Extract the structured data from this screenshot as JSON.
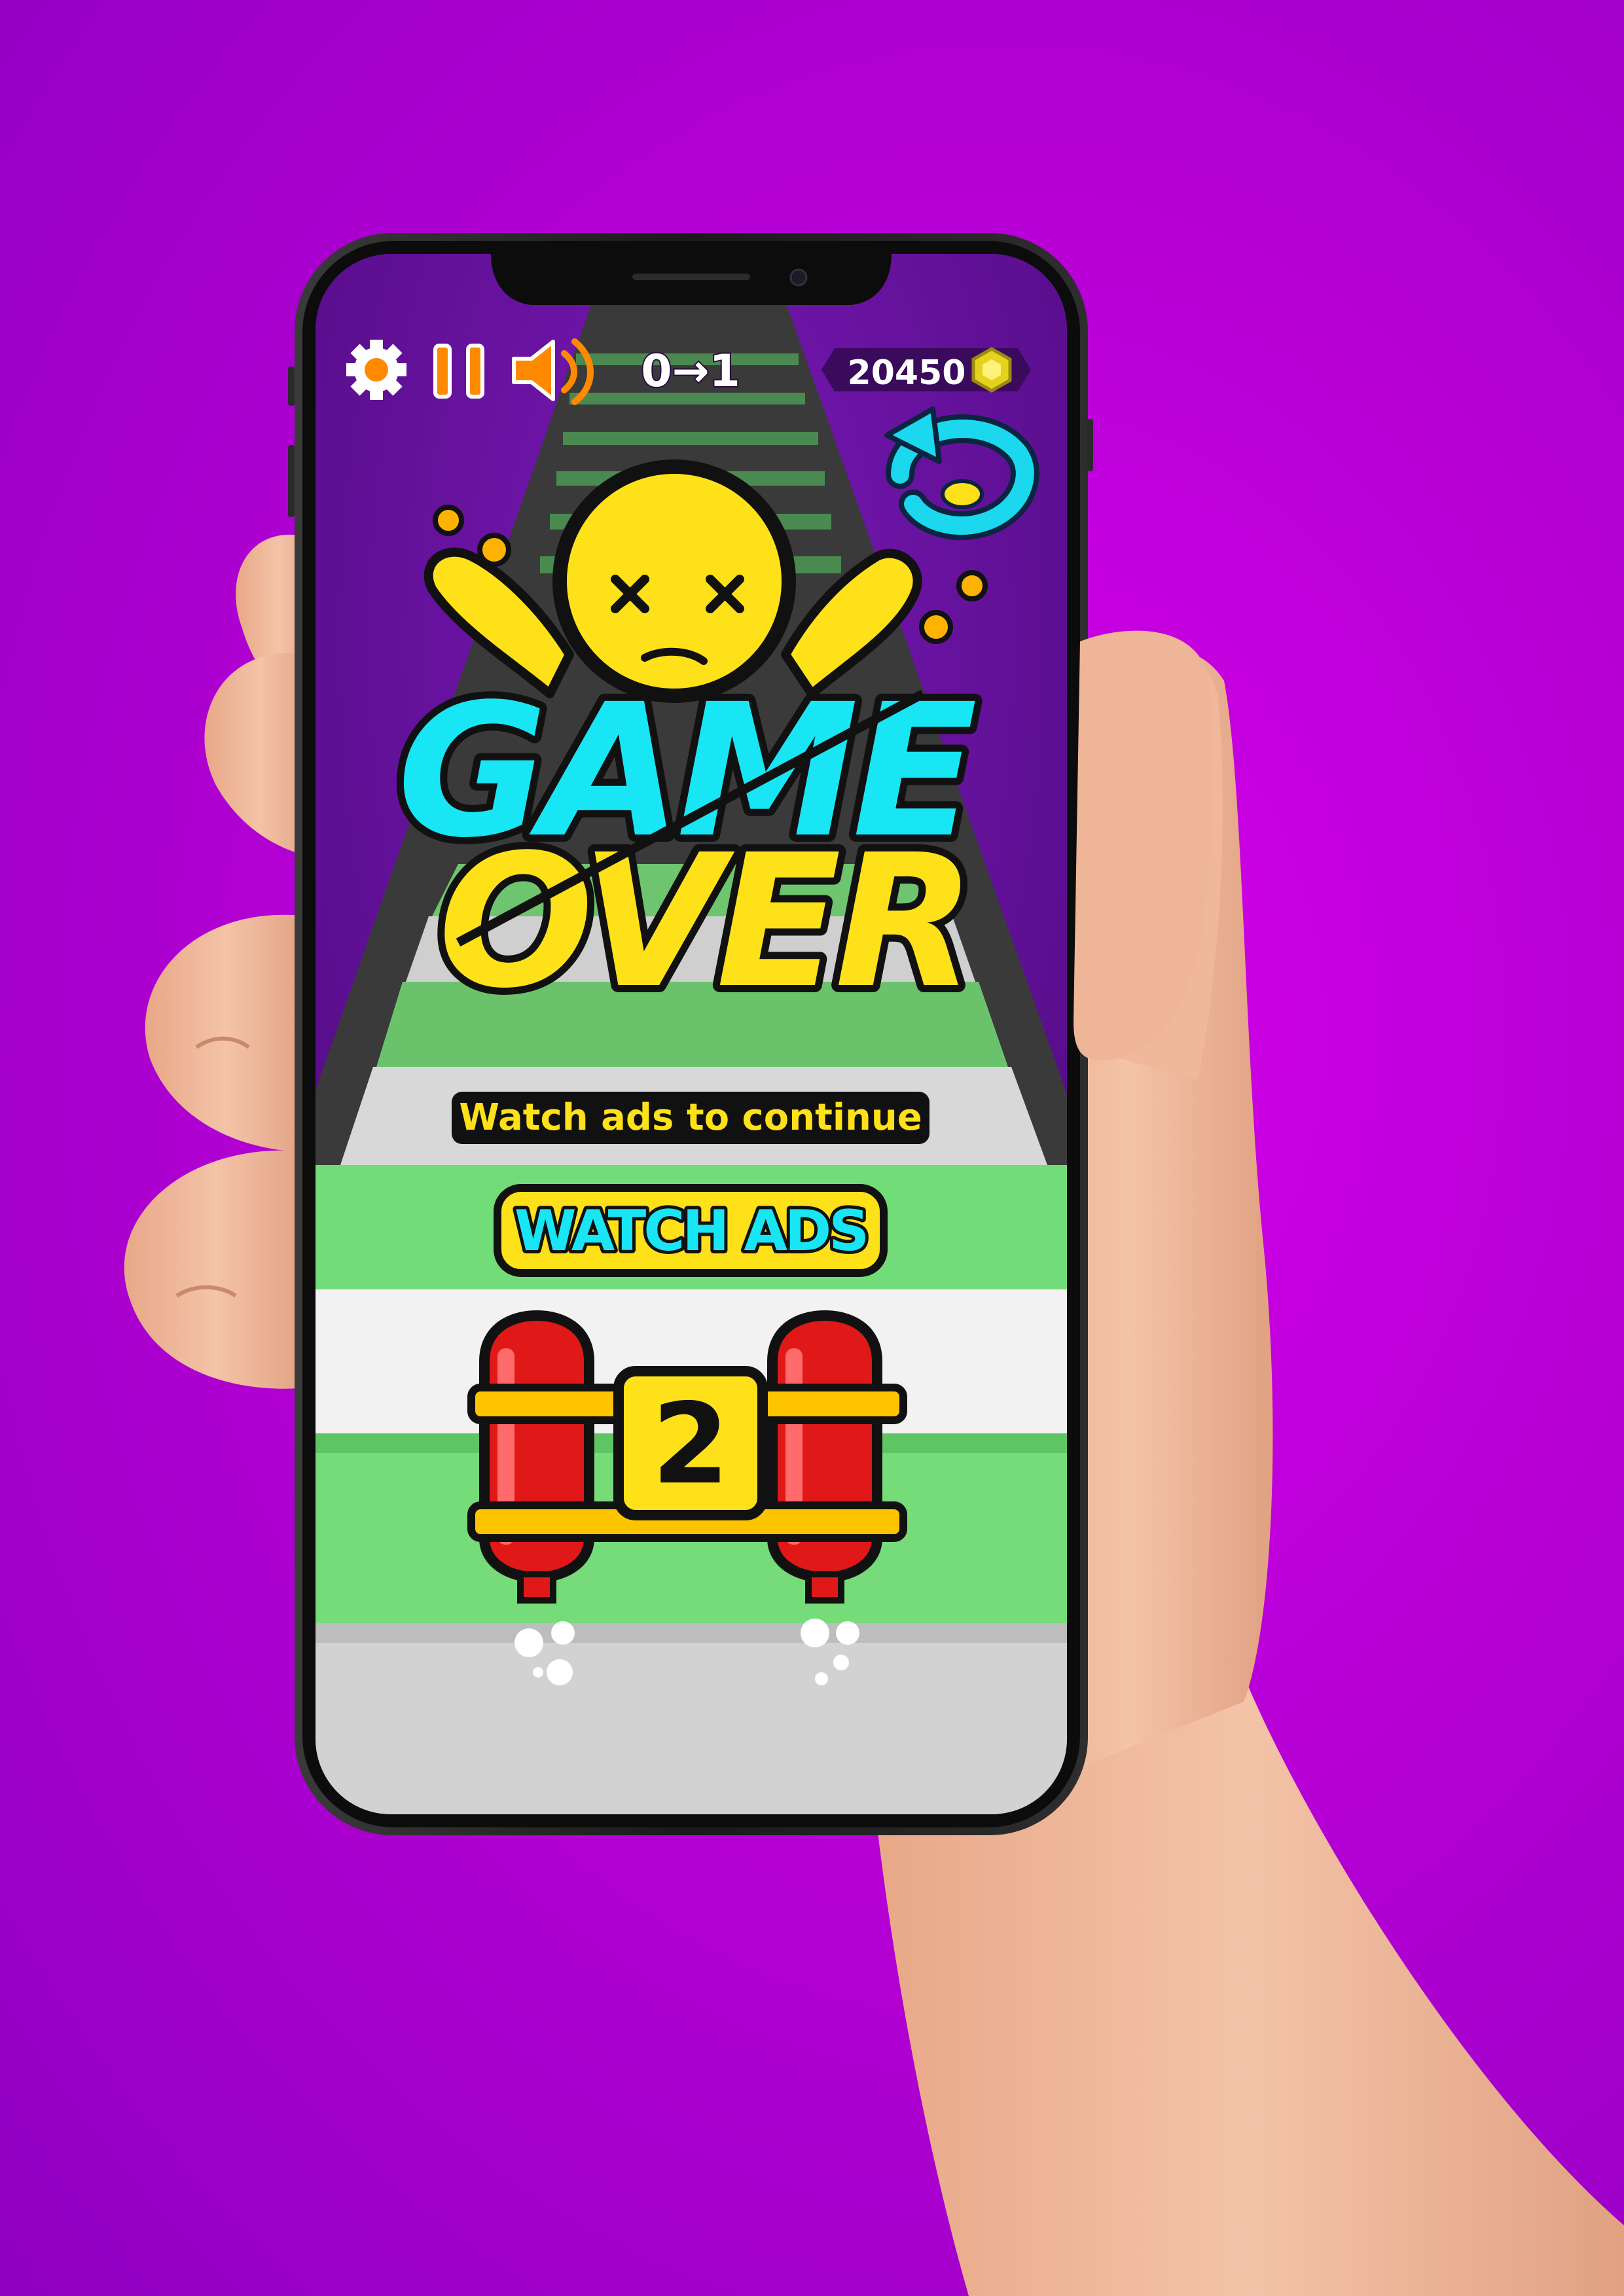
{
  "hud": {
    "level_progress": "0→1",
    "coins": "20450",
    "icons": [
      "gear-icon",
      "pause-icon",
      "speaker-icon",
      "coin-icon",
      "replay-icon"
    ]
  },
  "game_over": {
    "line1": "GAME",
    "line2": "OVER",
    "prompt": "Watch ads to continue",
    "watch_button": "WATCH ADS",
    "countdown": "2"
  },
  "colors": {
    "background": "#b700d6",
    "title_cyan": "#19e6f5",
    "title_yellow": "#ffe11a",
    "accent_orange": "#ff8a00",
    "dynamite_red": "#e01818",
    "stair_green": "#6fdc74"
  }
}
